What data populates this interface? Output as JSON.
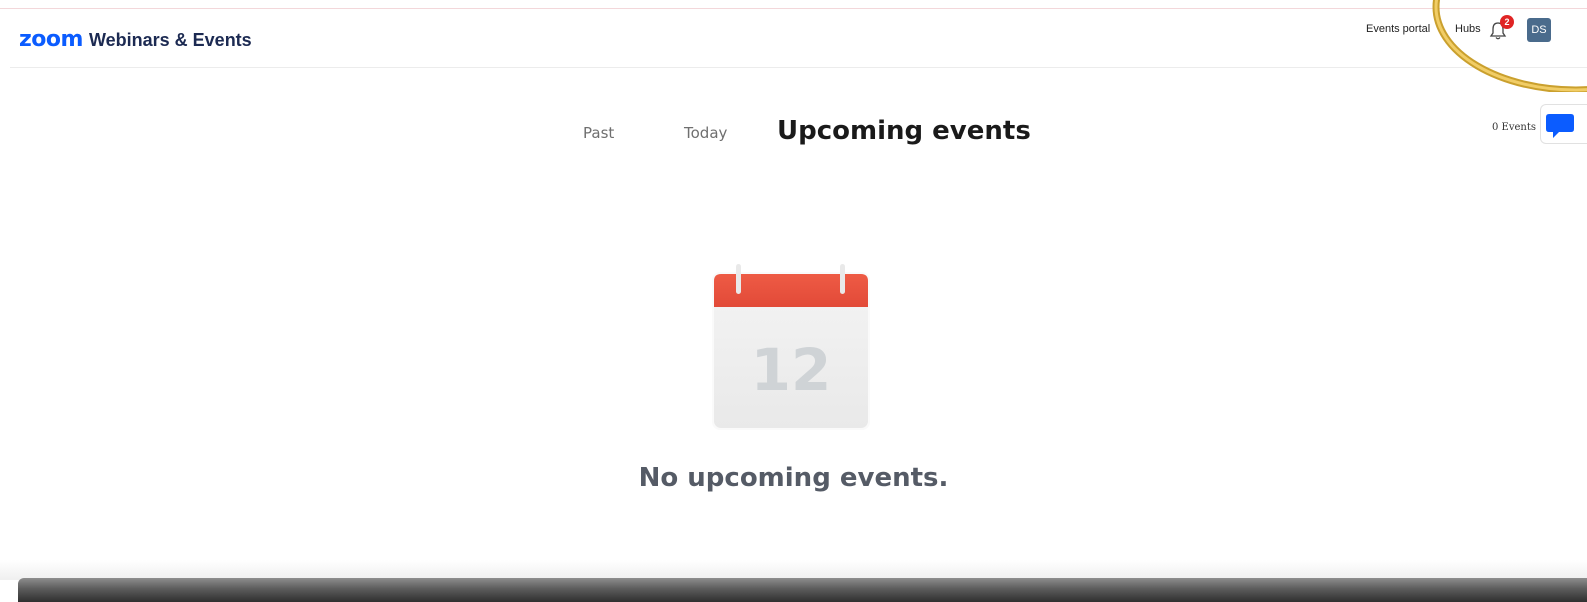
{
  "header": {
    "logo_brand": "zoom",
    "logo_product": "Webinars & Events",
    "links": {
      "events_portal": "Events portal",
      "hubs": "Hubs"
    },
    "notifications_badge": "2",
    "avatar_initials": "DS"
  },
  "tabs": {
    "past": "Past",
    "today": "Today",
    "upcoming": "Upcoming events"
  },
  "events_count": "0 Events",
  "empty_state": {
    "calendar_day": "12",
    "message": "No upcoming events."
  },
  "colors": {
    "brand_blue": "#0b5cff",
    "badge_red": "#e02424",
    "calendar_red": "#e8503f",
    "highlight_gold": "#e2b33a",
    "avatar_bg": "#4a6b8c"
  },
  "icons": {
    "bell": "bell-icon",
    "chat": "chat-bubble-icon",
    "calendar": "calendar-illustration"
  }
}
